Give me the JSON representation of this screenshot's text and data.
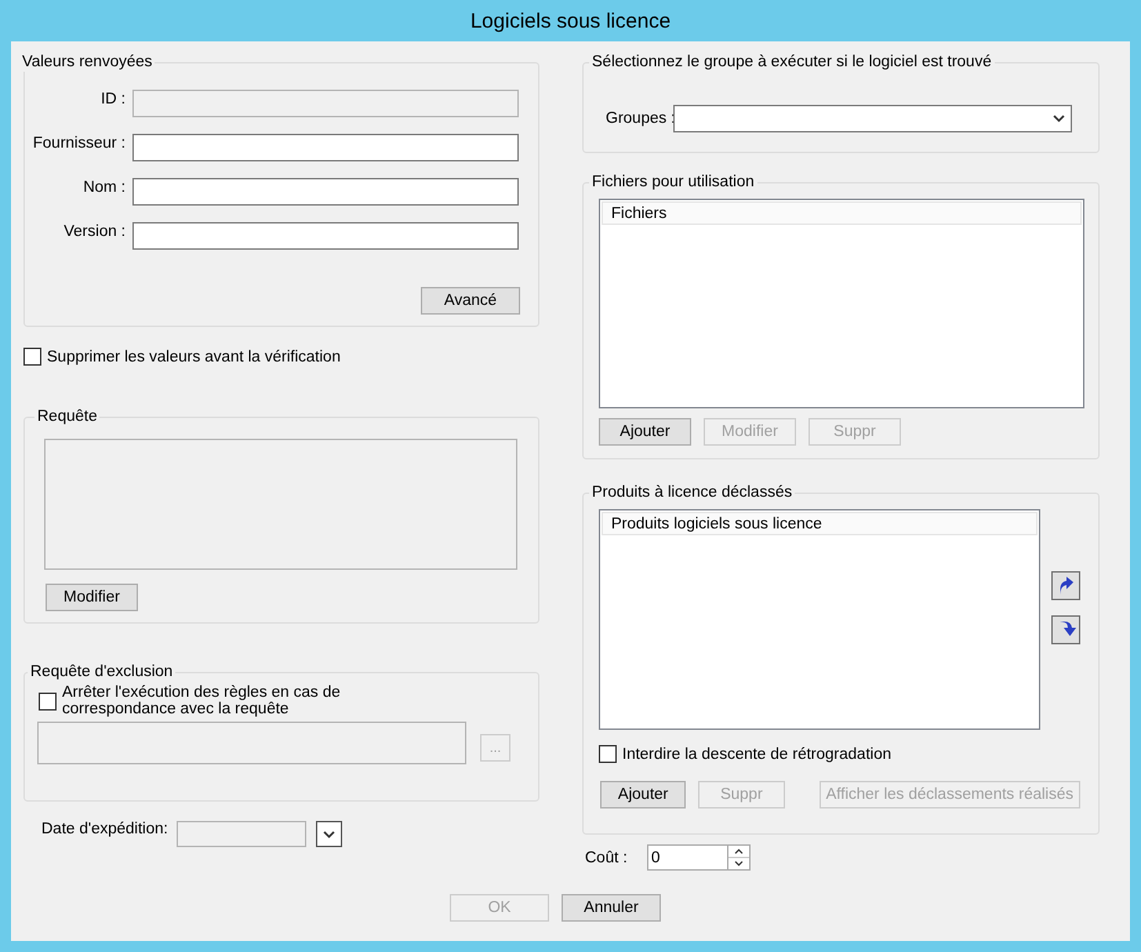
{
  "window": {
    "title": "Logiciels sous licence"
  },
  "returned_values": {
    "title": "Valeurs renvoyées",
    "fields": [
      {
        "label": "ID :",
        "disabled": true
      },
      {
        "label": "Fournisseur :",
        "disabled": false
      },
      {
        "label": "Nom :",
        "disabled": false
      },
      {
        "label": "Version :",
        "disabled": false
      }
    ],
    "advanced_button": {
      "label": "Avancé",
      "disabled": false
    }
  },
  "clear_values": {
    "label": "Supprimer les valeurs avant la vérification",
    "checked": false
  },
  "query": {
    "title": "Requête",
    "field": {
      "disabled": true
    },
    "button": {
      "label": "Modifier",
      "disabled": false
    }
  },
  "exclusion_query": {
    "title": "Requête d'exclusion",
    "stop_rules": {
      "label": "Arrêter l'exécution des règles en cas de correspondance avec la requête",
      "checked": false
    },
    "field": {
      "disabled": true
    },
    "browse_button": {
      "label": "...",
      "disabled": true
    }
  },
  "expiration_date": {
    "label": "Date d'expédition:",
    "disabled": true
  },
  "group_select": {
    "title": "Sélectionnez le groupe à exécuter si le logiciel est trouvé",
    "label": "Groupes :"
  },
  "files": {
    "title": "Fichiers pour utilisation",
    "column": "Fichiers",
    "buttons": [
      {
        "label": "Ajouter",
        "disabled": false
      },
      {
        "label": "Modifier",
        "disabled": true
      },
      {
        "label": "Suppr",
        "disabled": true
      }
    ]
  },
  "downgraded": {
    "title": "Produits à licence déclassés",
    "column": "Produits logiciels sous licence",
    "forbid_downgrade": {
      "label": "Interdire la descente de rétrogradation",
      "checked": false
    },
    "buttons": [
      {
        "label": "Ajouter",
        "disabled": false
      },
      {
        "label": "Suppr",
        "disabled": true
      },
      {
        "label": "Afficher les déclassements réalisés",
        "disabled": true
      }
    ]
  },
  "cost": {
    "label": "Coût :",
    "value": "0"
  },
  "dialog_buttons": [
    {
      "label": "OK",
      "disabled": true
    },
    {
      "label": "Annuler",
      "disabled": false
    }
  ]
}
